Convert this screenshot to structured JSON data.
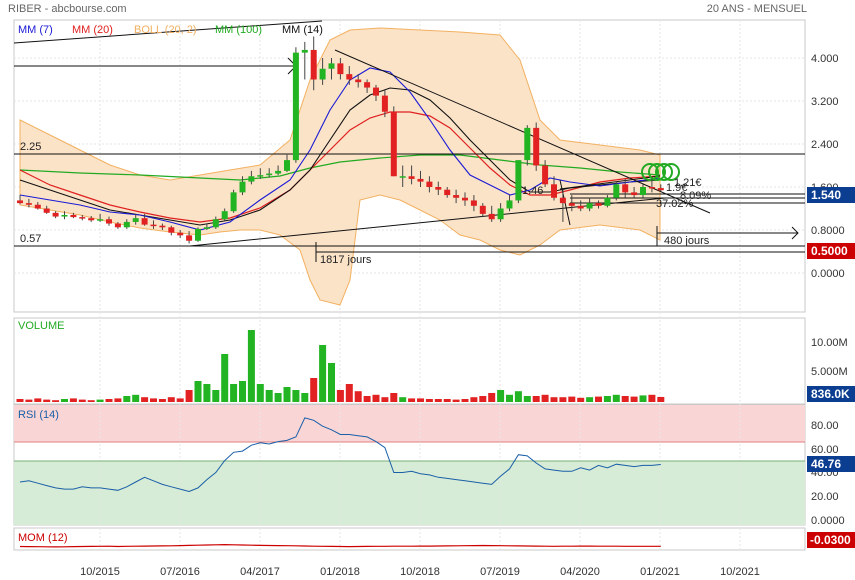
{
  "header": {
    "left": "RIBER - abcbourse.com",
    "right": "20 ANS - MENSUEL"
  },
  "panels": {
    "price": {
      "legend": [
        {
          "label": "MM (7)",
          "color": "#1a1ad6"
        },
        {
          "label": "MM (20)",
          "color": "#e02020"
        },
        {
          "label": "BOLL (20, 2)",
          "color": "#f3b060"
        },
        {
          "label": "MM (100)",
          "color": "#22aa22"
        },
        {
          "label": "MM (14)",
          "color": "#111111"
        }
      ],
      "y_ticks": [
        4.0,
        3.2,
        2.4,
        1.6,
        0.8,
        0.0
      ],
      "y_tick_labels": [
        "4.000",
        "3.200",
        "2.400",
        "1.600",
        "0.8000",
        "0.0000"
      ],
      "last_price_label": "1.540",
      "support_label": "0.5000",
      "level_labels": {
        "top": "2.25",
        "bottom": "0.57"
      },
      "annotations": {
        "days_1": "1817 jours",
        "days_2": "480 jours",
        "price_mark": "1.46",
        "pct_1": "1.21€",
        "pct_2": "37.02%",
        "pct_3": "8.09%",
        "pct_4": "1.9€"
      }
    },
    "volume": {
      "title": "VOLUME",
      "y_tick_labels": [
        "10.00M",
        "5.000M"
      ],
      "last_label": "836.0K"
    },
    "rsi": {
      "title": "RSI (14)",
      "y_tick_labels": [
        "80.00",
        "60.00",
        "40.00",
        "20.00",
        "0.0000"
      ],
      "last_label": "46.76"
    },
    "mom": {
      "title": "MOM (12)",
      "last_label": "-0.0300"
    }
  },
  "x_axis": {
    "labels": [
      "10/2015",
      "07/2016",
      "04/2017",
      "01/2018",
      "10/2018",
      "07/2019",
      "04/2020",
      "01/2021",
      "10/2021"
    ]
  },
  "colors": {
    "up": "#22b422",
    "down": "#e22222",
    "boll_fill": "#fbe3c8",
    "boll_line": "#f3b060",
    "label_bg": "#0b3d91",
    "support_bg": "#cc0000",
    "mom_bg": "#cc0000"
  },
  "chart_data": [
    {
      "type": "candlestick",
      "title": "RIBER",
      "x": [
        "2015-01",
        "2015-02",
        "2015-03",
        "2015-04",
        "2015-05",
        "2015-06",
        "2015-07",
        "2015-08",
        "2015-09",
        "2015-10",
        "2015-11",
        "2015-12",
        "2016-01",
        "2016-02",
        "2016-03",
        "2016-04",
        "2016-05",
        "2016-06",
        "2016-07",
        "2016-08",
        "2016-09",
        "2016-10",
        "2016-11",
        "2016-12",
        "2017-01",
        "2017-02",
        "2017-03",
        "2017-04",
        "2017-05",
        "2017-06",
        "2017-07",
        "2017-08",
        "2017-09",
        "2017-10",
        "2017-11",
        "2017-12",
        "2018-01",
        "2018-02",
        "2018-03",
        "2018-04",
        "2018-05",
        "2018-06",
        "2018-07",
        "2018-08",
        "2018-09",
        "2018-10",
        "2018-11",
        "2018-12",
        "2019-01",
        "2019-02",
        "2019-03",
        "2019-04",
        "2019-05",
        "2019-06",
        "2019-07",
        "2019-08",
        "2019-09",
        "2019-10",
        "2019-11",
        "2019-12",
        "2020-01",
        "2020-02",
        "2020-03",
        "2020-04",
        "2020-05",
        "2020-06",
        "2020-07",
        "2020-08",
        "2020-09",
        "2020-10",
        "2020-11",
        "2020-12",
        "2021-01"
      ],
      "open": [
        1.35,
        1.3,
        1.27,
        1.2,
        1.12,
        1.05,
        1.08,
        1.04,
        1.02,
        0.98,
        1.0,
        0.92,
        0.85,
        0.95,
        1.02,
        0.9,
        0.88,
        0.85,
        0.75,
        0.7,
        0.6,
        0.82,
        0.85,
        1.0,
        1.15,
        1.5,
        1.7,
        1.8,
        1.82,
        1.85,
        1.9,
        2.1,
        4.1,
        4.15,
        3.6,
        3.8,
        3.9,
        3.7,
        3.6,
        3.55,
        3.45,
        3.3,
        3.0,
        1.8,
        1.8,
        1.75,
        1.7,
        1.6,
        1.55,
        1.45,
        1.4,
        1.35,
        1.25,
        1.1,
        1.0,
        1.2,
        1.35,
        2.1,
        2.7,
        2.0,
        1.65,
        1.4,
        1.3,
        1.25,
        1.2,
        1.3,
        1.25,
        1.4,
        1.65,
        1.5,
        1.45,
        1.6,
        1.58
      ],
      "high": [
        1.45,
        1.38,
        1.32,
        1.25,
        1.15,
        1.15,
        1.12,
        1.08,
        1.06,
        1.1,
        1.05,
        0.95,
        1.0,
        1.1,
        1.1,
        0.98,
        0.92,
        0.88,
        0.8,
        0.78,
        0.85,
        0.92,
        1.05,
        1.2,
        1.55,
        1.8,
        1.9,
        1.95,
        1.95,
        2.0,
        2.2,
        4.2,
        4.3,
        4.4,
        4.0,
        4.0,
        4.0,
        3.85,
        3.7,
        3.6,
        3.5,
        3.4,
        3.1,
        2.0,
        2.0,
        1.9,
        1.8,
        1.7,
        1.6,
        1.55,
        1.5,
        1.45,
        1.3,
        1.25,
        1.3,
        1.45,
        2.1,
        2.75,
        2.8,
        2.1,
        1.8,
        1.55,
        1.45,
        1.35,
        1.4,
        1.35,
        1.45,
        1.7,
        1.75,
        1.6,
        1.65,
        1.75,
        1.65
      ],
      "low": [
        1.28,
        1.22,
        1.18,
        1.1,
        1.02,
        1.0,
        1.02,
        0.98,
        0.95,
        0.95,
        0.88,
        0.82,
        0.82,
        0.9,
        0.88,
        0.82,
        0.8,
        0.7,
        0.65,
        0.55,
        0.58,
        0.8,
        0.82,
        0.98,
        1.12,
        1.45,
        1.65,
        1.75,
        1.78,
        1.82,
        1.88,
        2.05,
        3.6,
        3.4,
        3.5,
        3.6,
        3.6,
        3.5,
        3.45,
        3.35,
        3.2,
        2.9,
        1.8,
        1.6,
        1.65,
        1.6,
        1.5,
        1.45,
        1.4,
        1.3,
        1.25,
        1.15,
        1.05,
        0.95,
        0.95,
        1.15,
        1.3,
        2.0,
        1.9,
        1.6,
        1.35,
        0.95,
        1.15,
        1.15,
        1.15,
        1.2,
        1.22,
        1.35,
        1.4,
        1.4,
        1.4,
        1.5,
        1.52
      ],
      "close": [
        1.3,
        1.27,
        1.2,
        1.12,
        1.05,
        1.08,
        1.04,
        1.02,
        0.98,
        1.0,
        0.92,
        0.85,
        0.95,
        1.02,
        0.9,
        0.88,
        0.85,
        0.75,
        0.7,
        0.6,
        0.82,
        0.85,
        1.0,
        1.15,
        1.5,
        1.7,
        1.8,
        1.82,
        1.85,
        1.9,
        2.1,
        4.1,
        4.15,
        3.6,
        3.8,
        3.9,
        3.7,
        3.6,
        3.55,
        3.45,
        3.3,
        3.0,
        1.8,
        1.8,
        1.75,
        1.7,
        1.6,
        1.55,
        1.45,
        1.4,
        1.35,
        1.25,
        1.1,
        1.0,
        1.2,
        1.35,
        2.1,
        2.7,
        2.0,
        1.65,
        1.4,
        1.3,
        1.25,
        1.2,
        1.3,
        1.25,
        1.4,
        1.65,
        1.5,
        1.45,
        1.6,
        1.58,
        1.54
      ],
      "ylim": [
        -0.8,
        4.6
      ]
    },
    {
      "type": "bar",
      "title": "VOLUME",
      "values": [
        0.5,
        0.4,
        0.6,
        0.4,
        0.3,
        0.5,
        0.6,
        0.4,
        0.3,
        0.4,
        0.5,
        0.6,
        1.0,
        1.2,
        0.8,
        0.6,
        0.5,
        0.8,
        0.6,
        2.0,
        3.5,
        3.0,
        2.0,
        8.0,
        3.0,
        3.5,
        12.0,
        3.0,
        2.0,
        1.5,
        2.5,
        2.0,
        1.5,
        4.0,
        9.5,
        6.5,
        2.0,
        3.0,
        1.8,
        1.0,
        1.2,
        0.8,
        1.5,
        0.8,
        0.6,
        0.6,
        0.5,
        0.5,
        0.5,
        0.4,
        0.5,
        0.8,
        1.0,
        1.5,
        2.0,
        1.2,
        1.8,
        1.0,
        1.0,
        1.2,
        0.8,
        0.8,
        0.9,
        0.7,
        0.8,
        0.9,
        1.0,
        1.2,
        1.0,
        0.9,
        1.1,
        1.2,
        0.84
      ],
      "ylim": [
        0,
        14
      ]
    },
    {
      "type": "line",
      "title": "RSI (14)",
      "values": [
        32,
        33,
        31,
        29,
        27,
        26,
        26,
        28,
        27,
        27,
        26,
        25,
        28,
        32,
        36,
        33,
        30,
        28,
        26,
        24,
        27,
        34,
        40,
        50,
        57,
        58,
        63,
        65,
        64,
        66,
        67,
        70,
        86,
        84,
        79,
        76,
        72,
        72,
        71,
        70,
        66,
        61,
        40,
        40,
        41,
        39,
        38,
        36,
        35,
        34,
        33,
        32,
        31,
        30,
        37,
        43,
        55,
        54,
        48,
        43,
        42,
        41,
        41,
        44,
        42,
        46,
        44,
        47,
        46,
        45,
        46,
        46,
        46.76
      ],
      "ylim": [
        0,
        100
      ]
    },
    {
      "type": "line",
      "title": "MOM (12)",
      "values": [
        -0.05,
        -0.06,
        -0.07,
        -0.08,
        -0.09,
        -0.08,
        -0.06,
        -0.05,
        -0.04,
        -0.03,
        -0.02,
        -0.05,
        -0.03,
        -0.02,
        -0.01,
        0.0,
        0.01,
        0.02,
        0.04,
        0.06,
        0.08,
        0.1,
        0.12,
        0.14,
        0.12,
        0.1,
        0.08,
        0.06,
        0.05,
        0.04,
        0.03,
        0.02,
        0.0,
        -0.02,
        -0.03,
        -0.04,
        -0.05,
        -0.06,
        -0.05,
        -0.04,
        -0.03,
        -0.03,
        -0.02,
        -0.02,
        -0.02,
        -0.01,
        -0.01,
        0.0,
        0.01,
        0.02,
        0.03,
        0.04,
        0.05,
        0.04,
        0.03,
        0.02,
        0.01,
        0.0,
        -0.01,
        -0.02,
        -0.03,
        -0.02,
        -0.02,
        -0.01,
        -0.01,
        -0.02,
        -0.02,
        -0.02,
        -0.03,
        -0.03,
        -0.03,
        -0.03,
        -0.03
      ],
      "ylim": [
        -0.5,
        0.5
      ]
    }
  ]
}
